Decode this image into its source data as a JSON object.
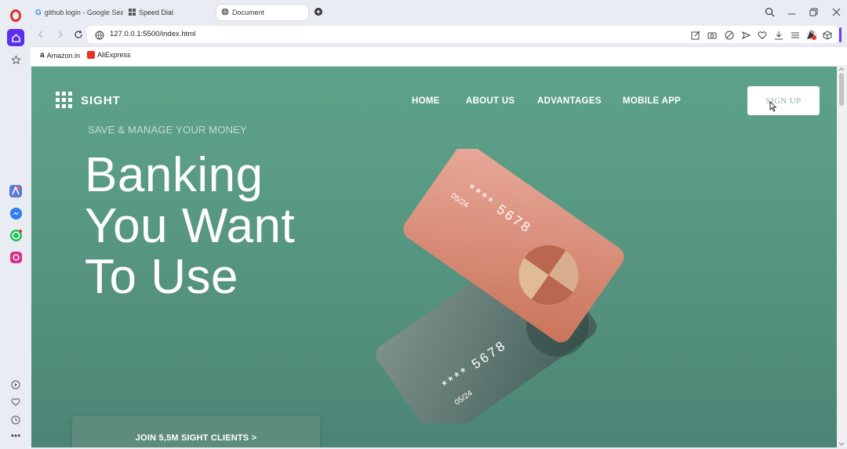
{
  "browser": {
    "tabs": [
      {
        "label": "github login - Google Search",
        "favicon": "google-icon"
      },
      {
        "label": "Speed Dial",
        "favicon": "grid-icon"
      },
      {
        "label": "Document",
        "favicon": "globe-icon",
        "active": true
      }
    ],
    "url": "127.0.0.1:5500/index.html",
    "bookmarks": [
      {
        "label": "Amazon.in",
        "icon": "amazon-icon"
      },
      {
        "label": "AliExpress",
        "icon": "aliexpress-icon"
      }
    ]
  },
  "site": {
    "logo_text": "SIGHT",
    "nav": [
      "HOME",
      "ABOUT US",
      "ADVANTAGES",
      "MOBILE APP"
    ],
    "signup_label": "SIGN UP",
    "tagline": "SAVE & MANAGE YOUR MONEY",
    "hero_lines": [
      "Banking",
      "You Want",
      "To Use"
    ],
    "join_label": "JOIN 5,5M SIGHT CLIENTS >",
    "card_front": {
      "number": "**** 5678",
      "expiry": "05/24"
    },
    "card_back": {
      "number": "**** 5678",
      "expiry": "05/24"
    }
  },
  "colors": {
    "page_green": "#579782",
    "card_front": "#d98a72",
    "card_back": "#5f7771",
    "opera_red": "#e0312b",
    "accent_purple": "#6b3df0"
  }
}
